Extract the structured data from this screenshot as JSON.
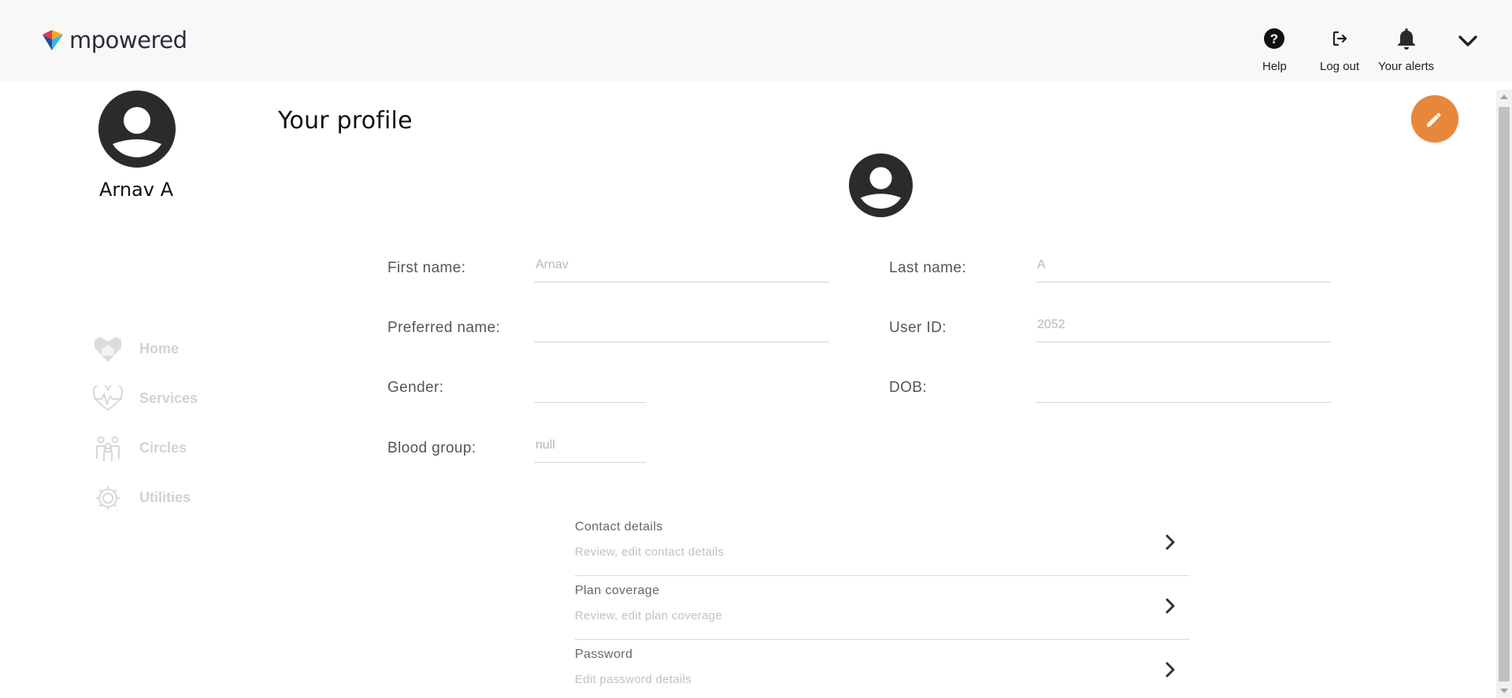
{
  "app": {
    "brand": "mpowered"
  },
  "header": {
    "help_label": "Help",
    "logout_label": "Log out",
    "alerts_label": "Your alerts"
  },
  "sidebar": {
    "user_name": "Arnav A",
    "items": [
      {
        "label": "Home",
        "icon": "heart-home-icon"
      },
      {
        "label": "Services",
        "icon": "heart-pulse-icon"
      },
      {
        "label": "Circles",
        "icon": "people-icon"
      },
      {
        "label": "Utilities",
        "icon": "gear-icon"
      }
    ]
  },
  "main": {
    "title": "Your profile",
    "fields": {
      "first_name": {
        "label": "First name:",
        "value": "Arnav"
      },
      "last_name": {
        "label": "Last name:",
        "value": "A"
      },
      "preferred_name": {
        "label": "Preferred name:",
        "value": ""
      },
      "user_id": {
        "label": "User ID:",
        "value": "2052"
      },
      "gender": {
        "label": "Gender:",
        "value": ""
      },
      "dob": {
        "label": "DOB:",
        "value": ""
      },
      "blood_group": {
        "label": "Blood group:",
        "value": "null"
      }
    },
    "links": [
      {
        "title": "Contact details",
        "subtitle": "Review, edit contact details"
      },
      {
        "title": "Plan coverage",
        "subtitle": "Review, edit plan coverage"
      },
      {
        "title": "Password",
        "subtitle": "Edit password details"
      }
    ]
  },
  "colors": {
    "accent": "#e8873a",
    "header_bg": "#f8f8f8",
    "nav_inactive": "#d2d2d2"
  }
}
